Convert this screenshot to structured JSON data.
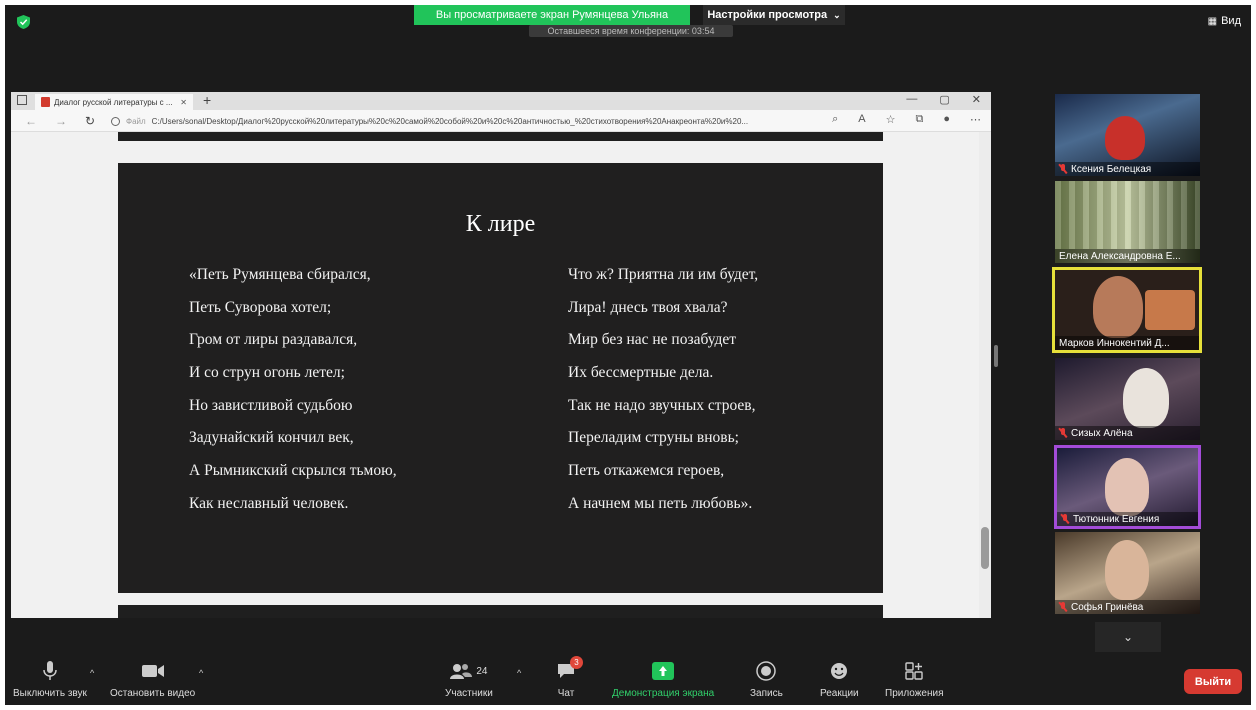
{
  "top": {
    "share_banner": "Вы просматриваете экран Румянцева Ульяна",
    "view_settings": "Настройки просмотра",
    "time_remaining": "Оставшееся время конференции: 03:54",
    "view_button": "Вид"
  },
  "browser": {
    "tab_title": "Диалог русской литературы с ...",
    "url_prefix": "Файл",
    "url": "C:/Users/sonal/Desktop/Диалог%20русской%20литературы%20с%20самой%20собой%20и%20с%20античностью_%20стихотворения%20Анакреонта%20и%20..."
  },
  "slide": {
    "title": "К лире",
    "left_lines": [
      "«Петь Румянцева сбирался,",
      "Петь Суворова хотел;",
      "Гром от лиры раздавался,",
      "И со струн огонь летел;",
      "Но завистливой судьбою",
      "Задунайский кончил век,",
      "А Рымникский скрылся тьмою,",
      "Как неславный человек."
    ],
    "right_lines": [
      "Что ж? Приятна ли им будет,",
      "Лира! днесь твоя хвала?",
      "Мир без нас не позабудет",
      "Их бессмертные дела.",
      "Так не надо звучных строев,",
      "Переладим струны вновь;",
      "Петь откажемся героев,",
      "А начнем мы петь любовь»."
    ]
  },
  "participants": [
    {
      "name": "Ксения Белецкая",
      "muted": true
    },
    {
      "name": "Елена Александровна Е...",
      "muted": false
    },
    {
      "name": "Марков Иннокентий Д...",
      "muted": false,
      "active_speaker": true
    },
    {
      "name": "Сизых Алёна",
      "muted": true
    },
    {
      "name": "Тютюнник Евгения",
      "muted": true
    },
    {
      "name": "Софья Гринёва",
      "muted": true
    }
  ],
  "toolbar": {
    "mute": "Выключить звук",
    "stop_video": "Остановить видео",
    "participants_label": "Участники",
    "participants_count": "24",
    "chat": "Чат",
    "chat_badge": "3",
    "share_screen": "Демонстрация экрана",
    "record": "Запись",
    "reactions": "Реакции",
    "apps": "Приложения",
    "leave": "Выйти"
  },
  "colors": {
    "share_green": "#21c45a",
    "leave_red": "#d63a31",
    "active_speaker": "#e6e03a",
    "highlight_purple": "#a34cd8"
  }
}
